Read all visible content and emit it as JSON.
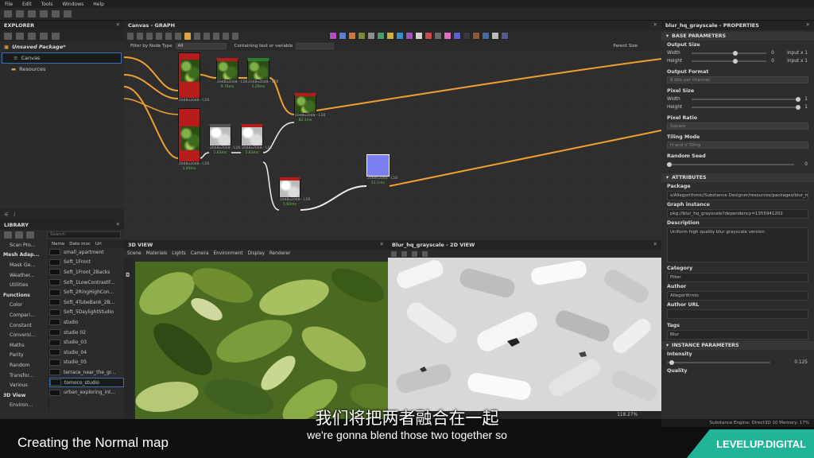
{
  "menu": [
    "File",
    "Edit",
    "Tools",
    "Windows",
    "Help"
  ],
  "explorer": {
    "title": "EXPLORER",
    "package": "Unsaved Package*",
    "canvas": "Canvas",
    "resources": "Resources"
  },
  "library": {
    "title": "LIBRARY",
    "search_placeholder": "Search",
    "col_name": "Name",
    "col_date": "Date moc",
    "col_url": "Url",
    "categories": [
      {
        "label": "Scan Pro...",
        "header": false
      },
      {
        "label": "Mesh Adap...",
        "header": true
      },
      {
        "label": "Mask Ge...",
        "header": false
      },
      {
        "label": "Weather...",
        "header": false
      },
      {
        "label": "Utilities",
        "header": false
      },
      {
        "label": "Functions",
        "header": true
      },
      {
        "label": "Color",
        "header": false
      },
      {
        "label": "Compari...",
        "header": false
      },
      {
        "label": "Constant",
        "header": false
      },
      {
        "label": "Conversi...",
        "header": false
      },
      {
        "label": "Maths",
        "header": false
      },
      {
        "label": "Parity",
        "header": false
      },
      {
        "label": "Random",
        "header": false
      },
      {
        "label": "Transfor...",
        "header": false
      },
      {
        "label": "Various",
        "header": false
      },
      {
        "label": "3D View",
        "header": true
      },
      {
        "label": "Environ...",
        "header": false
      }
    ],
    "items": [
      "small_apartment",
      "Soft_1Front",
      "Soft_1Front_2Backs",
      "Soft_1LowContrastF...",
      "Soft_2RingHighCon...",
      "Soft_4TubeBank_2B...",
      "Soft_5DaylightStudio",
      "studio",
      "studio 02",
      "studio_03",
      "studio_04",
      "studio_05",
      "terrace_near_the_gr...",
      "tomoco_studio",
      "urban_exploring_int..."
    ]
  },
  "graph": {
    "title": "Canvas - GRAPH",
    "filter_label": "Filter by Node Type",
    "filter_value": "All",
    "containing": "Containing text or variable",
    "parent_size": "Parent Size",
    "nodes": [
      {
        "label": "2048x2048 - L16",
        "value": ""
      },
      {
        "label": "2048x2048 - L16",
        "value": "9.76ms"
      },
      {
        "label": "2048x2048 - L16",
        "value": "1.29ms"
      },
      {
        "label": "2048x2048 - L16",
        "value": "82.1ms"
      },
      {
        "label": "2048x2048 - L16",
        "value": "3.49ms"
      },
      {
        "label": "2048x2048 - L16",
        "value": "1.63ms"
      },
      {
        "label": "2048x2048 - L16",
        "value": "5.63ms"
      },
      {
        "label": "2048x2048 - L16",
        "value": "5.92ms"
      },
      {
        "label": "2048x2048 - L16",
        "value": "11.1ms"
      }
    ]
  },
  "view3d": {
    "title": "3D VIEW",
    "menu": [
      "Scene",
      "Materials",
      "Lights",
      "Camera",
      "Environment",
      "Display",
      "Renderer"
    ]
  },
  "view2d": {
    "title": "Blur_hq_grayscale - 2D VIEW",
    "zoom": "118.27%"
  },
  "props": {
    "title": "blur_hq_grayscale - PROPERTIES",
    "base": "BASE PARAMETERS",
    "output_size": "Output Size",
    "width": "Width",
    "height": "Height",
    "w_val": "0",
    "h_val": "0",
    "w_inp": "Input x 1",
    "h_inp": "Input x 1",
    "output_format": "Output Format",
    "output_format_val": "8 bits per channel",
    "pixel_size": "Pixel Size",
    "ps_w": "1",
    "ps_h": "1",
    "pixel_ratio": "Pixel Ratio",
    "pixel_ratio_val": "Square",
    "tiling": "Tiling Mode",
    "tiling_val": "H and V Tiling",
    "seed": "Random Seed",
    "seed_val": "0",
    "attributes": "ATTRIBUTES",
    "package": "Package",
    "package_val": "s/Allegorithmic/Substance Designer/resources/packages/blur_hq.sbs",
    "graph_instance": "Graph instance",
    "graph_instance_val": "pkg://blur_hq_grayscale?dependency=1355941202",
    "description": "Description",
    "description_val": "Uniform high quality blur grayscale version",
    "category": "Category",
    "category_val": "Filter",
    "author": "Author",
    "author_val": "Allegorithmic",
    "author_url": "Author URL",
    "tags": "Tags",
    "tags_val": "Blur",
    "instance": "INSTANCE PARAMETERS",
    "intensity": "Intensity",
    "intensity_val": "0.125",
    "quality": "Quality"
  },
  "status": "Substance Engine: Direct3D 10   Memory: 17%",
  "caption": {
    "title": "Creating the Normal map",
    "cn": "我们将把两者融合在一起",
    "en": "we're gonna blend those two together so",
    "brand": "LEVELUP.DIGITAL"
  },
  "colors": {
    "accent": "#f0a030",
    "brand": "#21b597",
    "node_red": "#b71c1c",
    "node_blue": "#7b7ff0"
  }
}
